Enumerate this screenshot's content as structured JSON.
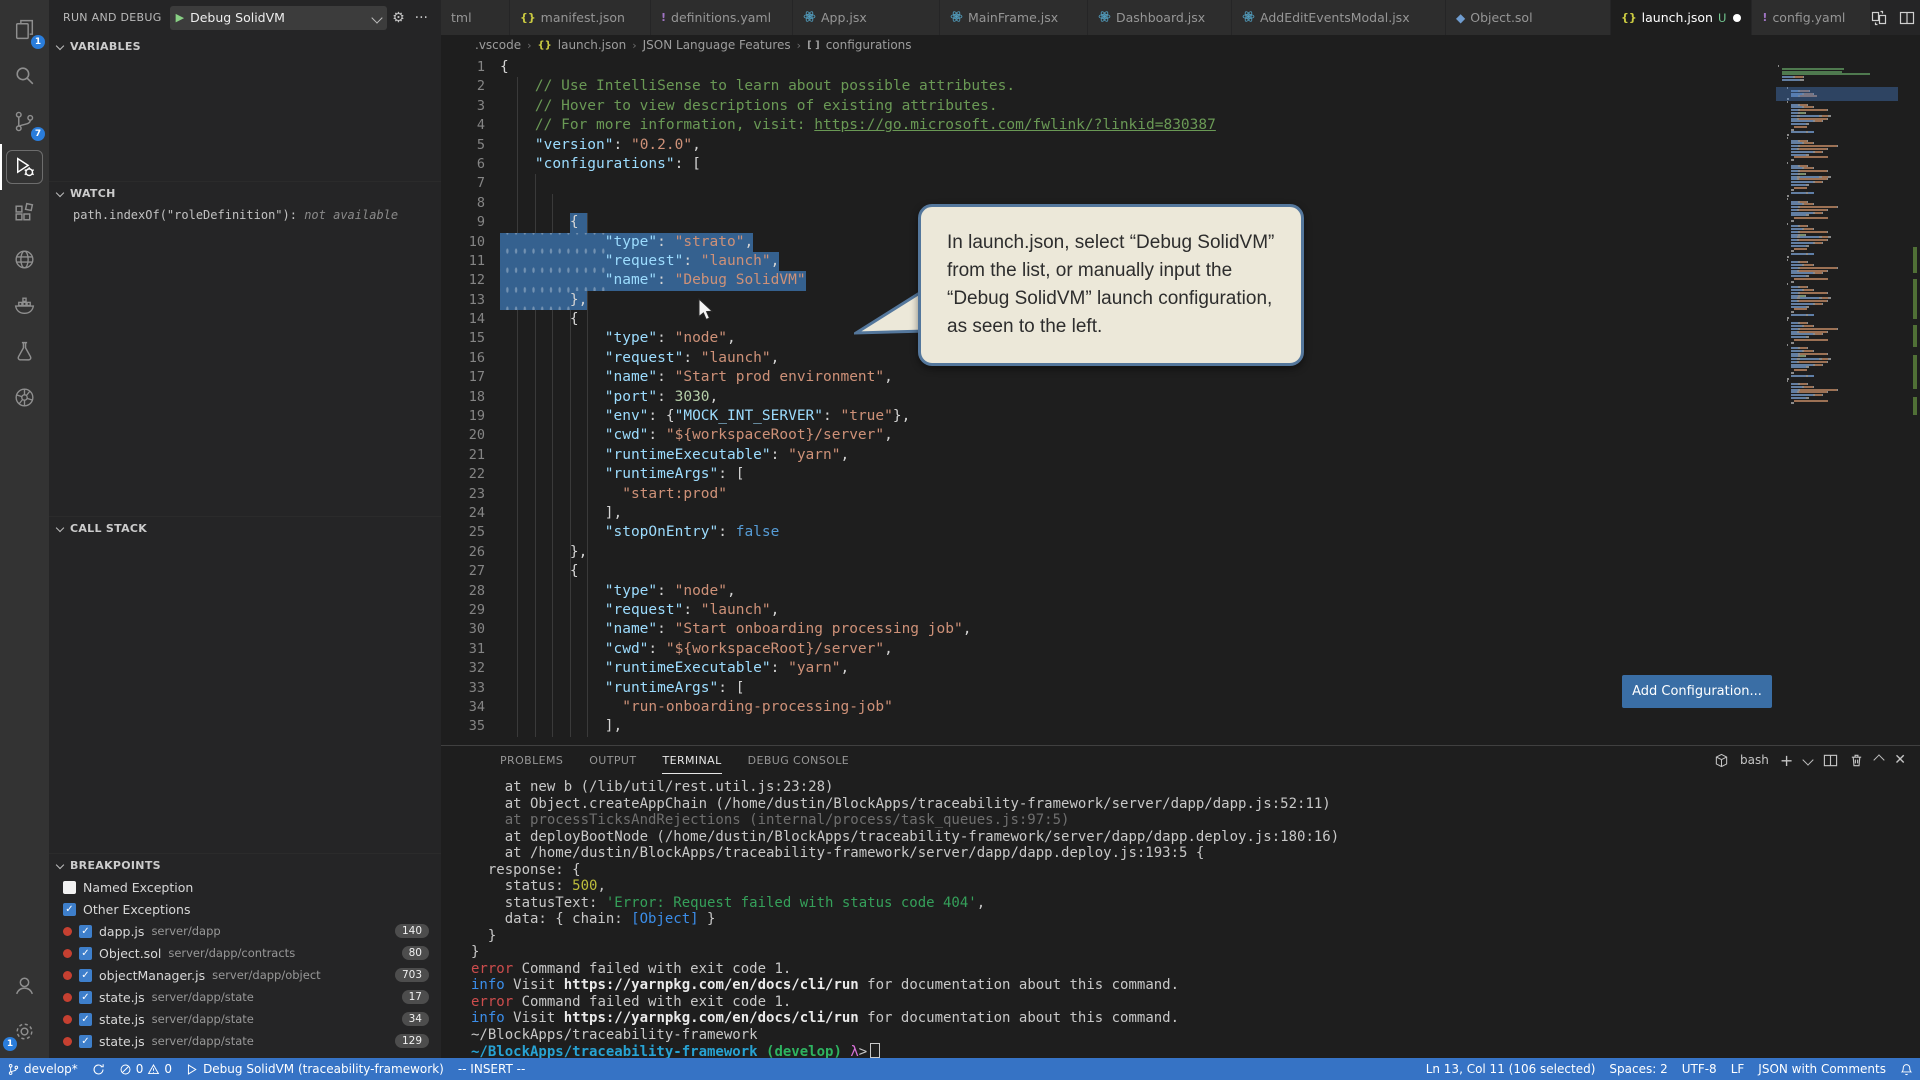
{
  "activity_bar": {
    "badges": {
      "explorer": "1",
      "source_control": "7",
      "settings": "1"
    }
  },
  "sidebar": {
    "title": "RUN AND DEBUG",
    "launch_config": "Debug SolidVM",
    "sections": {
      "variables": "VARIABLES",
      "watch": "WATCH",
      "call_stack": "CALL STACK",
      "breakpoints": "BREAKPOINTS"
    },
    "watch_item": {
      "expression": "path.indexOf(\"roleDefinition\"):",
      "value": "not available"
    },
    "breakpoints": {
      "exceptions": [
        {
          "label": "Named Exception",
          "checked": false
        },
        {
          "label": "Other Exceptions",
          "checked": true
        }
      ],
      "files": [
        {
          "file": "dapp.js",
          "path": "server/dapp",
          "line": "140"
        },
        {
          "file": "Object.sol",
          "path": "server/dapp/contracts",
          "line": "80"
        },
        {
          "file": "objectManager.js",
          "path": "server/dapp/object",
          "line": "703"
        },
        {
          "file": "state.js",
          "path": "server/dapp/state",
          "line": "17"
        },
        {
          "file": "state.js",
          "path": "server/dapp/state",
          "line": "34"
        },
        {
          "file": "state.js",
          "path": "server/dapp/state",
          "line": "129"
        }
      ]
    }
  },
  "tabs": [
    {
      "label": "tml",
      "icon": null
    },
    {
      "label": "manifest.json",
      "icon": "json"
    },
    {
      "label": "definitions.yaml",
      "icon": "yaml"
    },
    {
      "label": "App.jsx",
      "icon": "react"
    },
    {
      "label": "MainFrame.jsx",
      "icon": "react"
    },
    {
      "label": "Dashboard.jsx",
      "icon": "react"
    },
    {
      "label": "AddEditEventsModal.jsx",
      "icon": "react"
    },
    {
      "label": "Object.sol",
      "icon": "solidity"
    },
    {
      "label": "launch.json",
      "icon": "json",
      "active": true,
      "git": "U",
      "dirty": true
    },
    {
      "label": "config.yaml",
      "icon": "yaml"
    }
  ],
  "breadcrumb": [
    {
      "label": ".vscode"
    },
    {
      "label": "launch.json",
      "icon": "json"
    },
    {
      "label": "JSON Language Features"
    },
    {
      "label": "configurations",
      "icon": "array"
    }
  ],
  "editor": {
    "lines": [
      {
        "n": 1,
        "t": [
          [
            "p",
            "{"
          ]
        ]
      },
      {
        "n": 2,
        "t": [
          [
            "c",
            "    // Use IntelliSense to learn about possible attributes."
          ]
        ]
      },
      {
        "n": 3,
        "t": [
          [
            "c",
            "    // Hover to view descriptions of existing attributes."
          ]
        ]
      },
      {
        "n": 4,
        "t": [
          [
            "c",
            "    // For more information, visit: "
          ],
          [
            "u",
            "https://go.microsoft.com/fwlink/?linkid=830387"
          ]
        ]
      },
      {
        "n": 5,
        "t": [
          [
            "k",
            "    \"version\""
          ],
          [
            "p",
            ": "
          ],
          [
            "s",
            "\"0.2.0\""
          ],
          [
            "p",
            ","
          ]
        ]
      },
      {
        "n": 6,
        "t": [
          [
            "k",
            "    \"configurations\""
          ],
          [
            "p",
            ": ["
          ]
        ]
      },
      {
        "n": 7,
        "t": []
      },
      {
        "n": 8,
        "t": []
      },
      {
        "n": 9,
        "t": [
          [
            "p",
            "        {"
          ]
        ],
        "sel": [
          8,
          10
        ],
        "ws": 0
      },
      {
        "n": 10,
        "t": [
          [
            "k",
            "            \"type\""
          ],
          [
            "p",
            ": "
          ],
          [
            "s",
            "\"strato\""
          ],
          [
            "p",
            ","
          ]
        ],
        "sel": [
          0,
          29
        ],
        "ws": 12
      },
      {
        "n": 11,
        "t": [
          [
            "k",
            "            \"request\""
          ],
          [
            "p",
            ": "
          ],
          [
            "s",
            "\"launch\""
          ],
          [
            "p",
            ","
          ]
        ],
        "sel": [
          0,
          32
        ],
        "ws": 12
      },
      {
        "n": 12,
        "t": [
          [
            "k",
            "            \"name\""
          ],
          [
            "p",
            ": "
          ],
          [
            "s",
            "\"Debug SolidVM\""
          ]
        ],
        "sel": [
          0,
          35
        ],
        "ws": 12
      },
      {
        "n": 13,
        "t": [
          [
            "p",
            "        },"
          ]
        ],
        "sel": [
          0,
          10
        ],
        "ws": 8
      },
      {
        "n": 14,
        "t": [
          [
            "p",
            "        {"
          ]
        ]
      },
      {
        "n": 15,
        "t": [
          [
            "k",
            "            \"type\""
          ],
          [
            "p",
            ": "
          ],
          [
            "s",
            "\"node\""
          ],
          [
            "p",
            ","
          ]
        ]
      },
      {
        "n": 16,
        "t": [
          [
            "k",
            "            \"request\""
          ],
          [
            "p",
            ": "
          ],
          [
            "s",
            "\"launch\""
          ],
          [
            "p",
            ","
          ]
        ]
      },
      {
        "n": 17,
        "t": [
          [
            "k",
            "            \"name\""
          ],
          [
            "p",
            ": "
          ],
          [
            "s",
            "\"Start prod environment\""
          ],
          [
            "p",
            ","
          ]
        ]
      },
      {
        "n": 18,
        "t": [
          [
            "k",
            "            \"port\""
          ],
          [
            "p",
            ": "
          ],
          [
            "n",
            "3030"
          ],
          [
            "p",
            ","
          ]
        ]
      },
      {
        "n": 19,
        "t": [
          [
            "k",
            "            \"env\""
          ],
          [
            "p",
            ": {"
          ],
          [
            "k",
            "\"MOCK_INT_SERVER\""
          ],
          [
            "p",
            ": "
          ],
          [
            "s",
            "\"true\""
          ],
          [
            "p",
            "},"
          ]
        ]
      },
      {
        "n": 20,
        "t": [
          [
            "k",
            "            \"cwd\""
          ],
          [
            "p",
            ": "
          ],
          [
            "s",
            "\"${workspaceRoot}/server\""
          ],
          [
            "p",
            ","
          ]
        ]
      },
      {
        "n": 21,
        "t": [
          [
            "k",
            "            \"runtimeExecutable\""
          ],
          [
            "p",
            ": "
          ],
          [
            "s",
            "\"yarn\""
          ],
          [
            "p",
            ","
          ]
        ]
      },
      {
        "n": 22,
        "t": [
          [
            "k",
            "            \"runtimeArgs\""
          ],
          [
            "p",
            ": ["
          ]
        ]
      },
      {
        "n": 23,
        "t": [
          [
            "s",
            "              \"start:prod\""
          ]
        ]
      },
      {
        "n": 24,
        "t": [
          [
            "p",
            "            ],"
          ]
        ]
      },
      {
        "n": 25,
        "t": [
          [
            "k",
            "            \"stopOnEntry\""
          ],
          [
            "p",
            ": "
          ],
          [
            "b",
            "false"
          ]
        ]
      },
      {
        "n": 26,
        "t": [
          [
            "p",
            "        },"
          ]
        ]
      },
      {
        "n": 27,
        "t": [
          [
            "p",
            "        {"
          ]
        ]
      },
      {
        "n": 28,
        "t": [
          [
            "k",
            "            \"type\""
          ],
          [
            "p",
            ": "
          ],
          [
            "s",
            "\"node\""
          ],
          [
            "p",
            ","
          ]
        ]
      },
      {
        "n": 29,
        "t": [
          [
            "k",
            "            \"request\""
          ],
          [
            "p",
            ": "
          ],
          [
            "s",
            "\"launch\""
          ],
          [
            "p",
            ","
          ]
        ]
      },
      {
        "n": 30,
        "t": [
          [
            "k",
            "            \"name\""
          ],
          [
            "p",
            ": "
          ],
          [
            "s",
            "\"Start onboarding processing job\""
          ],
          [
            "p",
            ","
          ]
        ]
      },
      {
        "n": 31,
        "t": [
          [
            "k",
            "            \"cwd\""
          ],
          [
            "p",
            ": "
          ],
          [
            "s",
            "\"${workspaceRoot}/server\""
          ],
          [
            "p",
            ","
          ]
        ]
      },
      {
        "n": 32,
        "t": [
          [
            "k",
            "            \"runtimeExecutable\""
          ],
          [
            "p",
            ": "
          ],
          [
            "s",
            "\"yarn\""
          ],
          [
            "p",
            ","
          ]
        ]
      },
      {
        "n": 33,
        "t": [
          [
            "k",
            "            \"runtimeArgs\""
          ],
          [
            "p",
            ": ["
          ]
        ]
      },
      {
        "n": 34,
        "t": [
          [
            "s",
            "              \"run-onboarding-processing-job\""
          ]
        ]
      },
      {
        "n": 35,
        "t": [
          [
            "p",
            "            ],"
          ]
        ]
      }
    ]
  },
  "callout": {
    "text": "In launch.json, select “Debug SolidVM” from the list, or manually input the “Debug SolidVM” launch configuration, as seen to the left."
  },
  "add_configuration_label": "Add Configuration...",
  "panel": {
    "tabs": [
      "PROBLEMS",
      "OUTPUT",
      "TERMINAL",
      "DEBUG CONSOLE"
    ],
    "active_tab": "TERMINAL",
    "shell": "bash",
    "terminal_lines": [
      {
        "t": [
          [
            "w",
            "    at new b (/lib/util/rest.util.js:23:28)"
          ]
        ]
      },
      {
        "t": [
          [
            "w",
            "    at Object.createAppChain (/home/dustin/BlockApps/traceability-framework/server/dapp/dapp.js:52:11)"
          ]
        ]
      },
      {
        "t": [
          [
            "d",
            "    at processTicksAndRejections (internal/process/task_queues.js:97:5)"
          ]
        ]
      },
      {
        "t": [
          [
            "w",
            "    at deployBootNode (/home/dustin/BlockApps/traceability-framework/server/dapp/dapp.deploy.js:180:16)"
          ]
        ]
      },
      {
        "t": [
          [
            "w",
            "    at /home/dustin/BlockApps/traceability-framework/server/dapp/dapp.deploy.js:193:5 {"
          ]
        ]
      },
      {
        "t": [
          [
            "w",
            "  response: {"
          ]
        ]
      },
      {
        "t": [
          [
            "w",
            "    status: "
          ],
          [
            "y",
            "500"
          ],
          [
            "w",
            ","
          ]
        ]
      },
      {
        "t": [
          [
            "w",
            "    statusText: "
          ],
          [
            "g",
            "'Error: Request failed with status code 404'"
          ],
          [
            "w",
            ","
          ]
        ]
      },
      {
        "t": [
          [
            "w",
            "    data: { chain: "
          ],
          [
            "o",
            "[Object]"
          ],
          [
            "w",
            " }"
          ]
        ]
      },
      {
        "t": [
          [
            "w",
            "  }"
          ]
        ]
      },
      {
        "t": [
          [
            "w",
            "}"
          ]
        ]
      },
      {
        "t": [
          [
            "r",
            "error"
          ],
          [
            "w",
            " Command failed with exit code 1."
          ]
        ]
      },
      {
        "t": [
          [
            "i",
            "info"
          ],
          [
            "w",
            " Visit "
          ],
          [
            "b",
            "https://yarnpkg.com/en/docs/cli/run"
          ],
          [
            "w",
            " for documentation about this command."
          ]
        ]
      },
      {
        "t": [
          [
            "r",
            "error"
          ],
          [
            "w",
            " Command failed with exit code 1."
          ]
        ]
      },
      {
        "t": [
          [
            "i",
            "info"
          ],
          [
            "w",
            " Visit "
          ],
          [
            "b",
            "https://yarnpkg.com/en/docs/cli/run"
          ],
          [
            "w",
            " for documentation about this command."
          ]
        ]
      },
      {
        "t": [
          [
            "w",
            "~/BlockApps/traceability-framework"
          ]
        ]
      },
      {
        "t": [
          [
            "cy",
            "~/BlockApps/traceability-framework"
          ],
          [
            "w",
            " "
          ],
          [
            "gn",
            "(develop)"
          ],
          [
            "w",
            " "
          ],
          [
            "mg",
            "λ"
          ],
          [
            "w",
            ">"
          ],
          [
            "cur",
            ""
          ]
        ]
      }
    ]
  },
  "status_bar": {
    "branch": "develop*",
    "errors": "0",
    "warnings": "0",
    "debug_status": "Debug SolidVM (traceability-framework)",
    "mode": "-- INSERT --",
    "right": [
      "Ln 13, Col 11 (106 selected)",
      "Spaces: 2",
      "UTF-8",
      "LF",
      "JSON with Comments"
    ]
  }
}
